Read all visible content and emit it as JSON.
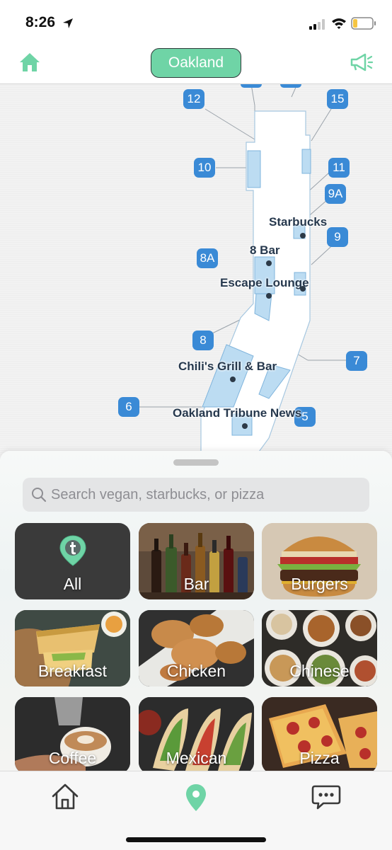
{
  "status_bar": {
    "time": "8:26",
    "icons": [
      "location-arrow-icon",
      "signal-icon",
      "wifi-icon",
      "battery-icon"
    ]
  },
  "top_nav": {
    "city": "Oakland",
    "icons": [
      "home-icon",
      "megaphone-icon"
    ],
    "accent": "#6fd4a6"
  },
  "map": {
    "gates": [
      "12",
      "15",
      "10",
      "11",
      "9A",
      "9",
      "8A",
      "8",
      "7",
      "6",
      "5"
    ],
    "gate_color": "#3a8ad6",
    "places": [
      "Starbucks",
      "8 Bar",
      "Escape Lounge",
      "Chili's Grill & Bar",
      "Oakland Tribune News"
    ]
  },
  "search": {
    "placeholder": "Search vegan, starbucks, or pizza",
    "value": ""
  },
  "categories": [
    {
      "label": "All",
      "icon": "location-pin-icon"
    },
    {
      "label": "Bar"
    },
    {
      "label": "Burgers"
    },
    {
      "label": "Breakfast"
    },
    {
      "label": "Chicken"
    },
    {
      "label": "Chinese"
    },
    {
      "label": "Coffee"
    },
    {
      "label": "Mexican"
    },
    {
      "label": "Pizza"
    }
  ],
  "tab_bar": {
    "tabs": [
      "home-tab-icon",
      "map-pin-tab-icon",
      "chat-tab-icon"
    ],
    "active_color": "#6fd4a6"
  }
}
